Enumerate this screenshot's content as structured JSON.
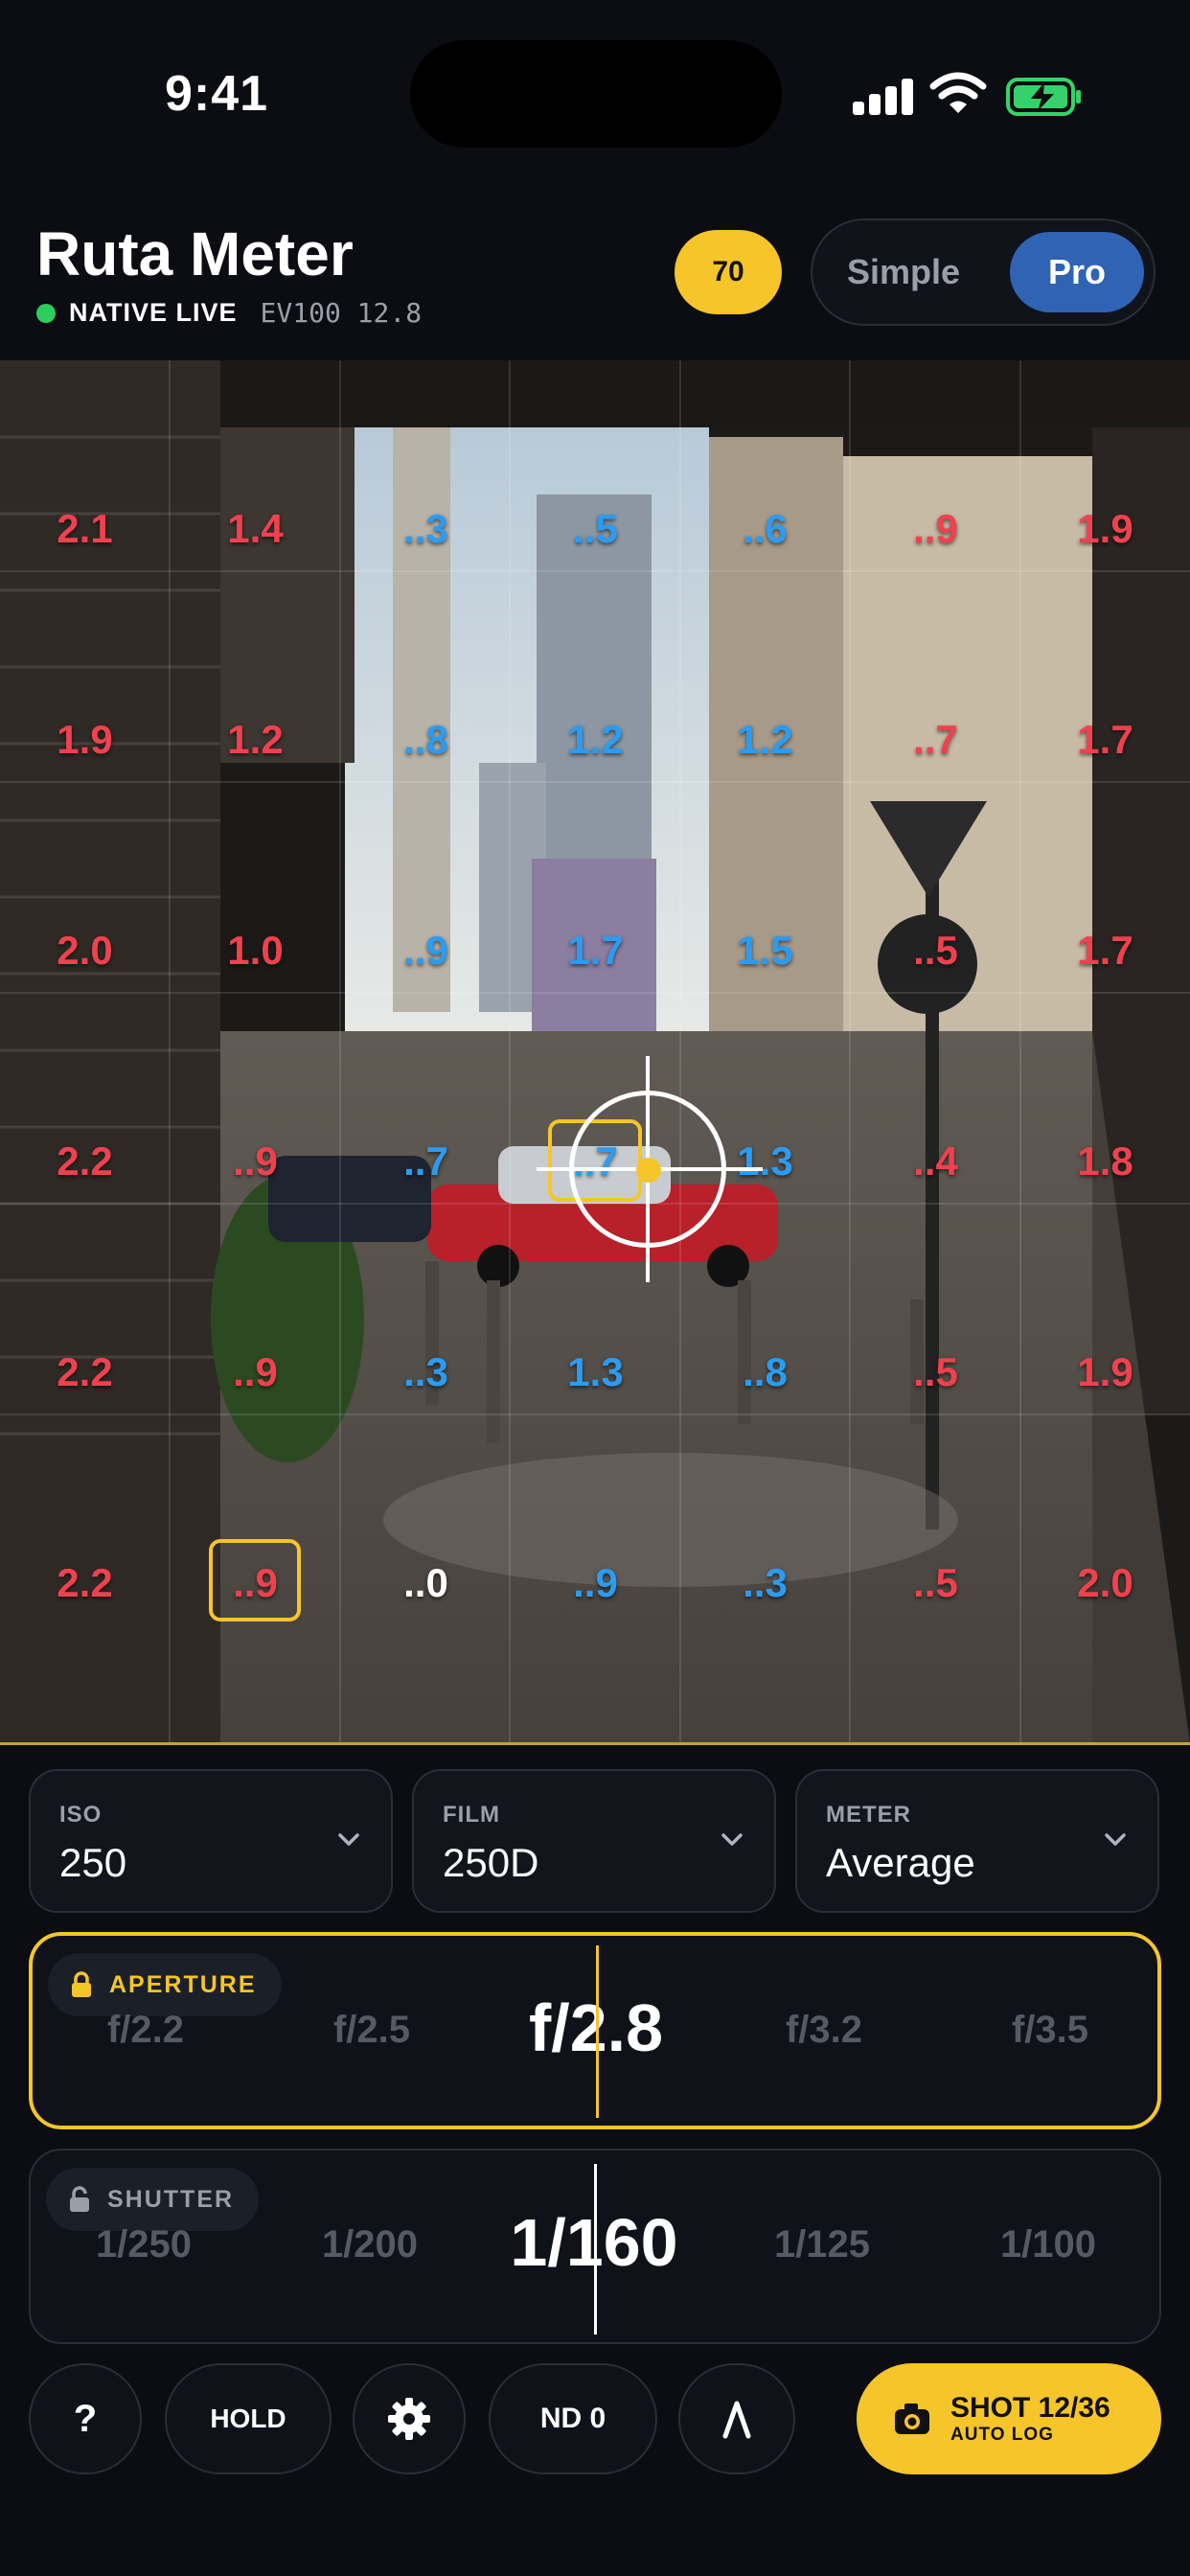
{
  "status_bar": {
    "time": "9:41"
  },
  "header": {
    "title": "Ruta Meter",
    "live_label": "NATIVE LIVE",
    "ev_label": "EV100 12.8",
    "badge": "70",
    "mode_simple": "Simple",
    "mode_pro": "Pro",
    "mode_selected": "Pro"
  },
  "meter_grid": {
    "rows": [
      [
        "2.1",
        "1.4",
        "..3",
        "..5",
        "..6",
        "..9",
        "1.9"
      ],
      [
        "1.9",
        "1.2",
        "..8",
        "1.2",
        "1.2",
        "..7",
        "1.7"
      ],
      [
        "2.0",
        "1.0",
        "..9",
        "1.7",
        "1.5",
        "..5",
        "1.7"
      ],
      [
        "2.2",
        "..9",
        "..7",
        "..7",
        "1.3",
        "..4",
        "1.8"
      ],
      [
        "2.2",
        "..9",
        "..3",
        "1.3",
        "..8",
        "..5",
        "1.9"
      ],
      [
        "2.2",
        "..9",
        "..0",
        "..9",
        "..3",
        "..5",
        "2.0"
      ]
    ],
    "colors": [
      [
        "red",
        "red",
        "blue",
        "blue",
        "blue",
        "red",
        "red"
      ],
      [
        "red",
        "red",
        "blue",
        "blue",
        "blue",
        "red",
        "red"
      ],
      [
        "red",
        "red",
        "blue",
        "blue",
        "blue",
        "red",
        "red"
      ],
      [
        "red",
        "red",
        "blue",
        "blue",
        "blue",
        "red",
        "red"
      ],
      [
        "red",
        "red",
        "blue",
        "blue",
        "blue",
        "red",
        "red"
      ],
      [
        "red",
        "red",
        "white",
        "blue",
        "blue",
        "red",
        "red"
      ]
    ],
    "palette": {
      "red": "#f0414f",
      "blue": "#2b9cf2",
      "white": "#ffffff",
      "accent": "#f5c52a"
    }
  },
  "controls": {
    "iso": {
      "label": "ISO",
      "value": "250"
    },
    "film": {
      "label": "FILM",
      "value": "250D"
    },
    "meter": {
      "label": "METER",
      "value": "Average"
    }
  },
  "aperture": {
    "label": "APERTURE",
    "locked": true,
    "options": [
      "f/2.2",
      "f/2.5",
      "f/2.8",
      "f/3.2",
      "f/3.5"
    ],
    "selected": "f/2.8"
  },
  "shutter": {
    "label": "SHUTTER",
    "locked": false,
    "options": [
      "1/250",
      "1/200",
      "1/160",
      "1/125",
      "1/100"
    ],
    "selected": "1/160"
  },
  "bottom_bar": {
    "help": "?",
    "hold": "HOLD",
    "settings_icon": "gear-icon",
    "nd": "ND 0",
    "shot_title": "SHOT 12/36",
    "shot_sub": "AUTO LOG"
  }
}
